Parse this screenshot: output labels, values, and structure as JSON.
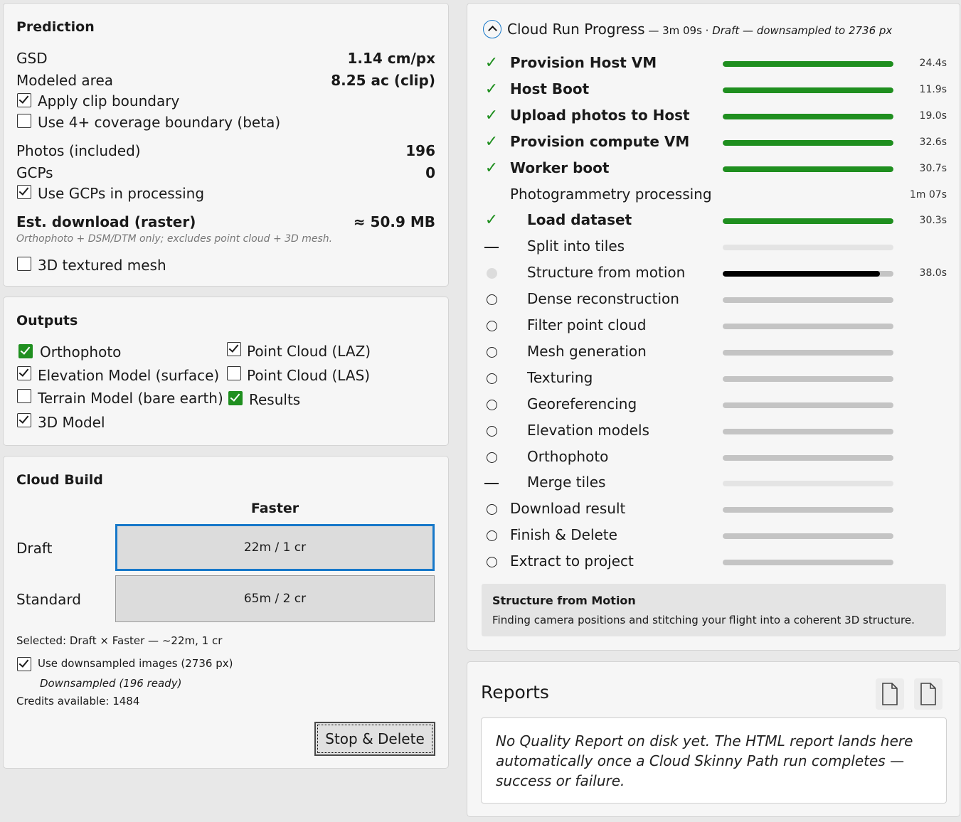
{
  "prediction": {
    "title": "Prediction",
    "gsd_label": "GSD",
    "gsd_value": "1.14 cm/px",
    "area_label": "Modeled area",
    "area_value": "8.25 ac (clip)",
    "clip_label": "Apply clip boundary",
    "clip_checked": true,
    "coverage_label": "Use 4+ coverage boundary (beta)",
    "coverage_checked": false,
    "photos_label": "Photos (included)",
    "photos_value": "196",
    "gcps_label": "GCPs",
    "gcps_value": "0",
    "use_gcps_label": "Use GCPs in processing",
    "use_gcps_checked": true,
    "download_label": "Est. download (raster)",
    "download_value": "≈ 50.9 MB",
    "download_note": "Orthophoto + DSM/DTM only; excludes point cloud + 3D mesh.",
    "mesh_label": "3D textured mesh",
    "mesh_checked": false
  },
  "outputs": {
    "title": "Outputs",
    "items": [
      {
        "label": "Orthophoto",
        "checked": true,
        "style": "green"
      },
      {
        "label": "Elevation Model (surface)",
        "checked": true
      },
      {
        "label": "Terrain Model (bare earth)",
        "checked": false
      },
      {
        "label": "3D Model",
        "checked": true
      },
      {
        "label": "Point Cloud (LAZ)",
        "checked": true
      },
      {
        "label": "Point Cloud (LAS)",
        "checked": false
      },
      {
        "label": "Results",
        "checked": true,
        "style": "green"
      }
    ]
  },
  "cloud_build": {
    "title": "Cloud Build",
    "column_header": "Faster",
    "rows": [
      {
        "label": "Draft",
        "option": "22m / 1 cr",
        "selected": true
      },
      {
        "label": "Standard",
        "option": "65m / 2 cr",
        "selected": false
      }
    ],
    "selected_text": "Selected: Draft × Faster — ~22m, 1 cr",
    "downsample_label": "Use downsampled images (2736 px)",
    "downsample_checked": true,
    "downsample_status": "Downsampled (196 ready)",
    "credits_text": "Credits available:  1484",
    "stop_label": "Stop & Delete"
  },
  "progress": {
    "title": "Cloud Run Progress",
    "meta_time": " — 3m 09s · ",
    "meta_detail": "Draft — downsampled to 2736 px",
    "steps": [
      {
        "label": "Provision Host VM",
        "status": "done",
        "bold": true,
        "indent": false,
        "progress": 1.0,
        "duration": "24.4s"
      },
      {
        "label": "Host Boot",
        "status": "done",
        "bold": true,
        "indent": false,
        "progress": 1.0,
        "duration": "11.9s"
      },
      {
        "label": "Upload photos to Host",
        "status": "done",
        "bold": true,
        "indent": false,
        "progress": 1.0,
        "duration": "19.0s"
      },
      {
        "label": "Provision compute VM",
        "status": "done",
        "bold": true,
        "indent": false,
        "progress": 1.0,
        "duration": "32.6s"
      },
      {
        "label": "Worker boot",
        "status": "done",
        "bold": true,
        "indent": false,
        "progress": 1.0,
        "duration": "30.7s"
      },
      {
        "label": "Photogrammetry processing",
        "status": "group",
        "bold": false,
        "indent": false,
        "progress": null,
        "duration": "1m 07s"
      },
      {
        "label": "Load dataset",
        "status": "done",
        "bold": true,
        "indent": true,
        "progress": 1.0,
        "duration": "30.3s"
      },
      {
        "label": "Split into tiles",
        "status": "skipped",
        "bold": false,
        "indent": true,
        "progress": 0,
        "duration": ""
      },
      {
        "label": "Structure from motion",
        "status": "running",
        "bold": false,
        "indent": true,
        "progress": 0.92,
        "duration": "38.0s"
      },
      {
        "label": "Dense reconstruction",
        "status": "pending",
        "bold": false,
        "indent": true,
        "progress": 0,
        "duration": ""
      },
      {
        "label": "Filter point cloud",
        "status": "pending",
        "bold": false,
        "indent": true,
        "progress": 0,
        "duration": ""
      },
      {
        "label": "Mesh generation",
        "status": "pending",
        "bold": false,
        "indent": true,
        "progress": 0,
        "duration": ""
      },
      {
        "label": "Texturing",
        "status": "pending",
        "bold": false,
        "indent": true,
        "progress": 0,
        "duration": ""
      },
      {
        "label": "Georeferencing",
        "status": "pending",
        "bold": false,
        "indent": true,
        "progress": 0,
        "duration": ""
      },
      {
        "label": "Elevation models",
        "status": "pending",
        "bold": false,
        "indent": true,
        "progress": 0,
        "duration": ""
      },
      {
        "label": "Orthophoto",
        "status": "pending",
        "bold": false,
        "indent": true,
        "progress": 0,
        "duration": ""
      },
      {
        "label": "Merge tiles",
        "status": "skipped",
        "bold": false,
        "indent": true,
        "progress": 0,
        "duration": ""
      },
      {
        "label": "Download result",
        "status": "pending",
        "bold": false,
        "indent": false,
        "progress": 0,
        "duration": ""
      },
      {
        "label": "Finish & Delete",
        "status": "pending",
        "bold": false,
        "indent": false,
        "progress": 0,
        "duration": ""
      },
      {
        "label": "Extract to project",
        "status": "pending",
        "bold": false,
        "indent": false,
        "progress": 0,
        "duration": ""
      }
    ],
    "info_title": "Structure from Motion",
    "info_text": "Finding camera positions and stitching your flight into a coherent 3D structure."
  },
  "reports": {
    "title": "Reports",
    "icons": [
      "document-icon",
      "document-icon"
    ],
    "message": "No Quality Report on disk yet. The HTML report lands here automatically once a Cloud Skinny Path run completes — success or failure."
  },
  "colors": {
    "done_fill": "#1f8f1f",
    "running_fill": "#000000",
    "pending_track": "#c4c4c4",
    "skipped_track": "#e4e4e4",
    "accent": "#1778c9"
  }
}
